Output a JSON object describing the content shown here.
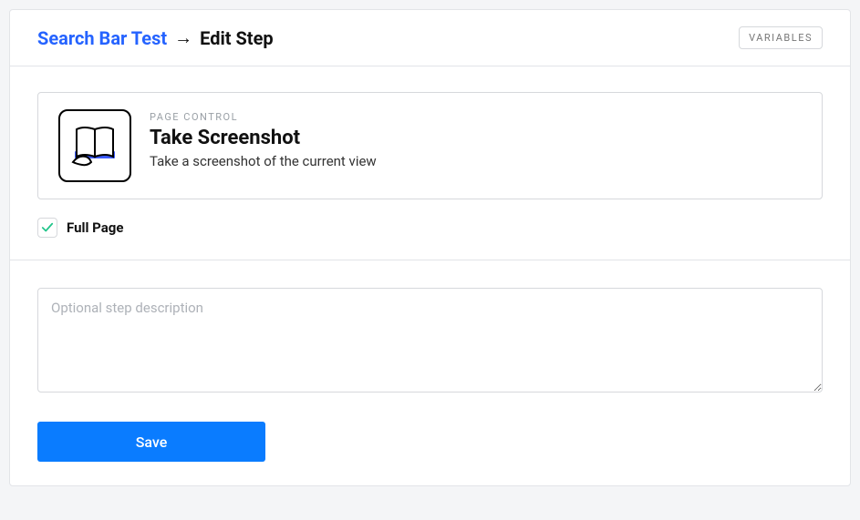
{
  "breadcrumb": {
    "link_text": "Search Bar Test",
    "arrow": "→",
    "current": "Edit Step"
  },
  "header": {
    "variables_button": "VARIABLES"
  },
  "step": {
    "category": "PAGE CONTROL",
    "title": "Take Screenshot",
    "description": "Take a screenshot of the current view"
  },
  "options": {
    "full_page_label": "Full Page",
    "full_page_checked": true
  },
  "form": {
    "description_placeholder": "Optional step description",
    "save_label": "Save"
  },
  "icons": {
    "step_icon": "book-open-icon",
    "check_icon": "check-icon"
  }
}
